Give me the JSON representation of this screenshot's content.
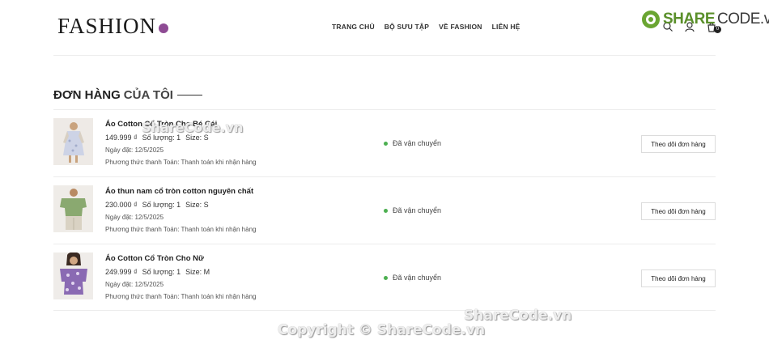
{
  "header": {
    "logo_text": "FASHION",
    "nav": [
      "TRANG CHỦ",
      "BỘ SƯU TẬP",
      "VỀ FASHION",
      "LIÊN HỆ"
    ],
    "cart_count": "0",
    "icons": [
      "search-icon",
      "user-icon",
      "cart-icon"
    ]
  },
  "brand_watermark": {
    "share": "SHARE",
    "code": "CODE.vn"
  },
  "page": {
    "title_bold": "ĐƠN HÀNG",
    "title_rest": "CỦA TÔI"
  },
  "orders": [
    {
      "name": "Áo Cotton Cổ Tròn Cho Bé Gái",
      "price": "149.999 ₫",
      "qty": "Số lượng: 1",
      "size": "Size: S",
      "date": "Ngày đặt: 12/5/2025",
      "payment": "Phương thức thanh Toán: Thanh toán khi nhận hàng",
      "status": "Đã vận chuyển",
      "action": "Theo dõi đơn hàng"
    },
    {
      "name": "Áo thun nam cổ tròn cotton nguyên chất",
      "price": "230.000 ₫",
      "qty": "Số lượng: 1",
      "size": "Size: S",
      "date": "Ngày đặt: 12/5/2025",
      "payment": "Phương thức thanh Toán: Thanh toán khi nhận hàng",
      "status": "Đã vận chuyển",
      "action": "Theo dõi đơn hàng"
    },
    {
      "name": "Áo Cotton Cổ Tròn Cho Nữ",
      "price": "249.999 ₫",
      "qty": "Số lượng: 1",
      "size": "Size: M",
      "date": "Ngày đặt: 12/5/2025",
      "payment": "Phương thức thanh Toán: Thanh toán khi nhận hàng",
      "status": "Đã vận chuyển",
      "action": "Theo dõi đơn hàng"
    }
  ],
  "watermarks": {
    "top": "ShareCode.vn",
    "bottom1": "ShareCode.vn",
    "bottom2": "Copyright © ShareCode.vn"
  },
  "colors": {
    "accent": "#8e4b94",
    "status_green": "#4caf50"
  }
}
